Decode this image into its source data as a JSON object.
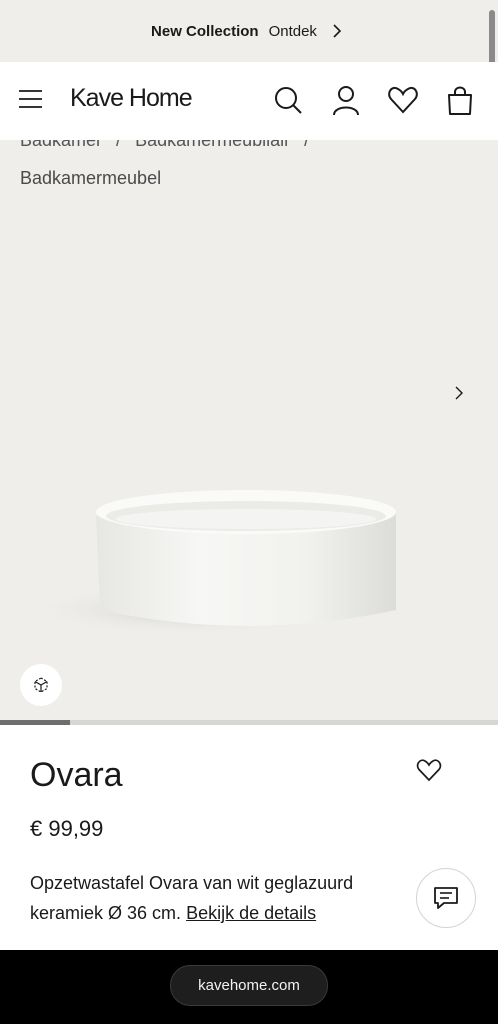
{
  "promo": {
    "title": "New Collection",
    "link": "Ontdek"
  },
  "header": {
    "logo": "Kave Home",
    "icons": [
      "menu-icon",
      "search-icon",
      "account-icon",
      "wishlist-icon",
      "bag-icon"
    ]
  },
  "breadcrumb": {
    "items": [
      "Badkamer",
      "/",
      "Badkamermeubilair",
      "/"
    ],
    "current": "Badkamermeubel"
  },
  "gallery": {
    "progress": 0.14
  },
  "product": {
    "name": "Ovara",
    "price": "€ 99,99",
    "description": "Opzetwastafel Ovara van wit geglazuurd keramiek Ø 36 cm.",
    "details_link": "Bekijk de details"
  },
  "browser": {
    "url": "kavehome.com"
  },
  "colors": {
    "page_bg": "#efeeeb",
    "text": "#1a1a1a",
    "bottom_bar": "#000000"
  }
}
